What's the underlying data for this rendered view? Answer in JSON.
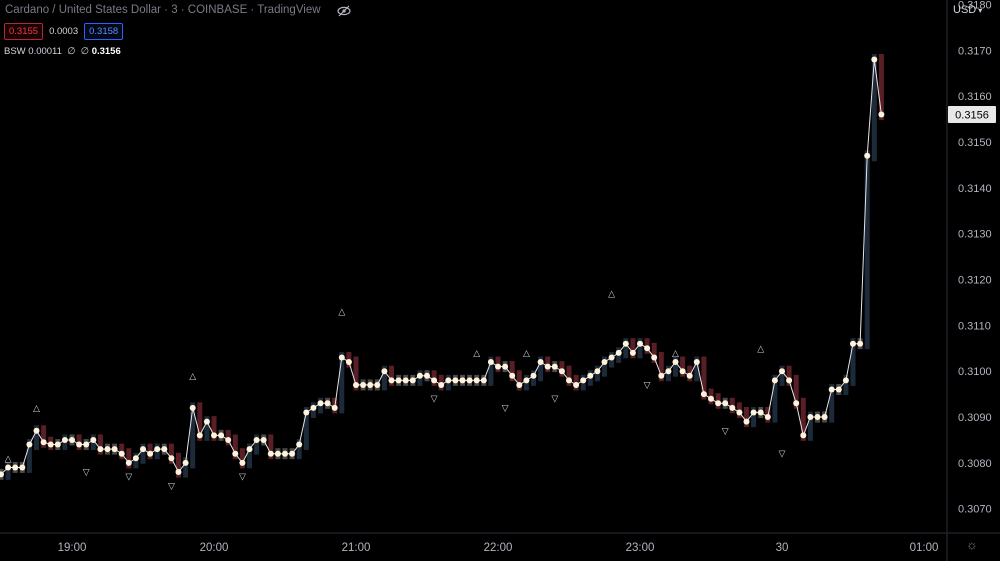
{
  "header": {
    "symbol_title": "Cardano / United States Dollar · 3 · COINBASE · TradingView",
    "bid": "0.3155",
    "spread": "0.0003",
    "ask": "0.3158",
    "indicator_name": "BSW",
    "indicator_value": "0.00011",
    "indicator_na1": "∅",
    "indicator_na2": "∅",
    "indicator_last": "0.3156"
  },
  "currency": "USD",
  "colors": {
    "background": "#000000",
    "up": "#1c2a3a",
    "down": "#5a1e26",
    "neutral": "#4a4a4a",
    "dot": "#fff3dc",
    "line": "#e6e6e6",
    "label": "#b2b5be"
  },
  "chart_data": {
    "type": "line",
    "title": "",
    "xlabel": "",
    "ylabel": "",
    "ylim": [
      0.30647,
      0.31788
    ],
    "grid": false,
    "x_ticks": [
      {
        "label": "19:00",
        "t": 10
      },
      {
        "label": "20:00",
        "t": 30
      },
      {
        "label": "21:00",
        "t": 50
      },
      {
        "label": "22:00",
        "t": 70
      },
      {
        "label": "23:00",
        "t": 90
      },
      {
        "label": "30",
        "t": 110
      },
      {
        "label": "01:00",
        "t": 130
      }
    ],
    "y_ticks": [
      "0.3070",
      "0.3080",
      "0.3090",
      "0.3100",
      "0.3110",
      "0.3120",
      "0.3130",
      "0.3140",
      "0.3150",
      "0.3160",
      "0.3170",
      "0.3180"
    ],
    "last_price_label": "0.3156",
    "last_price": 0.3156,
    "series": [
      {
        "values": [
          0.30775,
          0.3079,
          0.3079,
          0.3079,
          0.3084,
          0.3087,
          0.30845,
          0.3084,
          0.3084,
          0.3085,
          0.3085,
          0.3084,
          0.3084,
          0.3085,
          0.3083,
          0.3083,
          0.3083,
          0.3082,
          0.308,
          0.3081,
          0.3083,
          0.3082,
          0.3083,
          0.3083,
          0.3081,
          0.3078,
          0.308,
          0.3092,
          0.3086,
          0.3089,
          0.3086,
          0.3086,
          0.3085,
          0.3082,
          0.308,
          0.3083,
          0.3085,
          0.3085,
          0.3082,
          0.3082,
          0.3082,
          0.3082,
          0.3084,
          0.3091,
          0.3092,
          0.3093,
          0.3093,
          0.3092,
          0.3103,
          0.3102,
          0.3097,
          0.3097,
          0.3097,
          0.3097,
          0.31,
          0.3098,
          0.3098,
          0.3098,
          0.3098,
          0.3099,
          0.3099,
          0.3098,
          0.3097,
          0.3098,
          0.3098,
          0.3098,
          0.3098,
          0.3098,
          0.3098,
          0.3102,
          0.3101,
          0.3101,
          0.3099,
          0.3097,
          0.3098,
          0.3099,
          0.3102,
          0.3101,
          0.3101,
          0.31,
          0.3098,
          0.3097,
          0.3098,
          0.3099,
          0.31,
          0.3102,
          0.3103,
          0.3104,
          0.3106,
          0.3104,
          0.3106,
          0.3105,
          0.3103,
          0.3099,
          0.31,
          0.3102,
          0.31,
          0.3099,
          0.3102,
          0.3095,
          0.3094,
          0.3093,
          0.3093,
          0.3092,
          0.3091,
          0.3089,
          0.3091,
          0.3091,
          0.309,
          0.3098,
          0.31,
          0.3098,
          0.3093,
          0.3086,
          0.309,
          0.309,
          0.309,
          0.3096,
          0.3096,
          0.3098,
          0.3106,
          0.3106,
          0.3147,
          0.3168,
          0.3156
        ]
      }
    ],
    "annotations": [
      {
        "t": 1,
        "text": "△",
        "value": 0.3081
      },
      {
        "t": 5,
        "text": "△",
        "value": 0.3092
      },
      {
        "t": 12,
        "text": "▽",
        "value": 0.3078
      },
      {
        "t": 18,
        "text": "▽",
        "value": 0.3077
      },
      {
        "t": 24,
        "text": "▽",
        "value": 0.3075
      },
      {
        "t": 27,
        "text": "△",
        "value": 0.3099
      },
      {
        "t": 34,
        "text": "▽",
        "value": 0.3077
      },
      {
        "t": 48,
        "text": "△",
        "value": 0.3113
      },
      {
        "t": 61,
        "text": "▽",
        "value": 0.3094
      },
      {
        "t": 67,
        "text": "△",
        "value": 0.3104
      },
      {
        "t": 71,
        "text": "▽",
        "value": 0.3092
      },
      {
        "t": 74,
        "text": "△",
        "value": 0.3104
      },
      {
        "t": 78,
        "text": "▽",
        "value": 0.3094
      },
      {
        "t": 86,
        "text": "△",
        "value": 0.3117
      },
      {
        "t": 91,
        "text": "▽",
        "value": 0.3097
      },
      {
        "t": 95,
        "text": "△",
        "value": 0.3104
      },
      {
        "t": 102,
        "text": "▽",
        "value": 0.3087
      },
      {
        "t": 107,
        "text": "△",
        "value": 0.3105
      },
      {
        "t": 110,
        "text": "▽",
        "value": 0.3082
      }
    ]
  }
}
